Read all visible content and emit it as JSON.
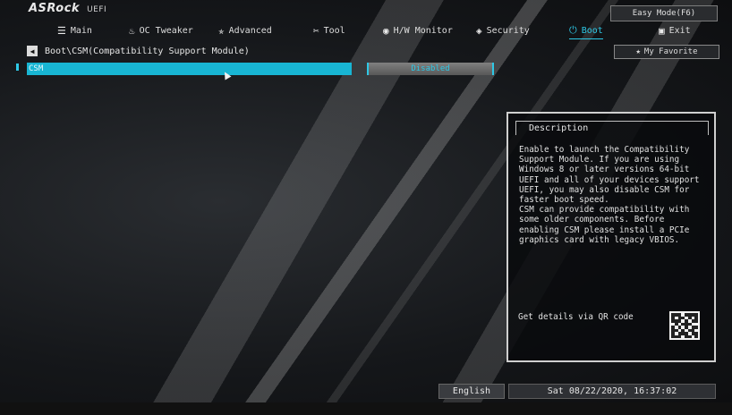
{
  "brand": {
    "name": "ASRock",
    "suffix": "UEFI"
  },
  "easy_mode_label": "Easy Mode(F6)",
  "nav": [
    {
      "label": "Main",
      "icon": "list-icon"
    },
    {
      "label": "OC Tweaker",
      "icon": "flame-icon"
    },
    {
      "label": "Advanced",
      "icon": "star-icon"
    },
    {
      "label": "Tool",
      "icon": "tools-icon"
    },
    {
      "label": "H/W Monitor",
      "icon": "monitor-icon"
    },
    {
      "label": "Security",
      "icon": "shield-icon"
    },
    {
      "label": "Boot",
      "icon": "power-icon",
      "active": true
    },
    {
      "label": "Exit",
      "icon": "exit-icon"
    }
  ],
  "favorite_label": "My Favorite",
  "breadcrumb": "Boot\\CSM(Compatibility Support Module)",
  "setting": {
    "label": "CSM",
    "value": "Disabled"
  },
  "description": {
    "title": "Description",
    "text": "Enable to launch the Compatibility\nSupport Module. If you are using\nWindows 8 or later versions 64-bit\nUEFI and all of your devices support\nUEFI, you may also disable CSM for\nfaster boot speed.\nCSM can provide compatibility with\nsome older components. Before\nenabling CSM please install a PCIe\ngraphics card with legacy VBIOS.",
    "qr_label": "Get details via QR code"
  },
  "footer": {
    "language": "English",
    "datetime": "Sat 08/22/2020, 16:37:02"
  },
  "colors": {
    "accent": "#2ec8e6",
    "selected_row": "#18b5d3"
  }
}
